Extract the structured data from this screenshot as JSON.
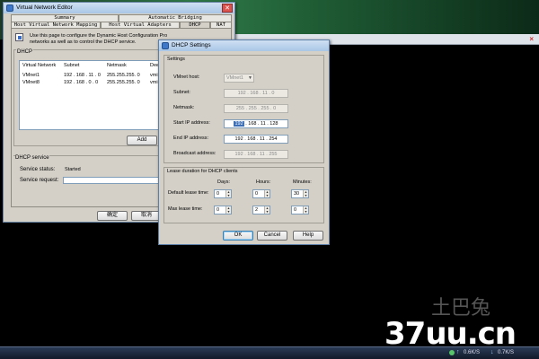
{
  "host": {
    "close_mark": "×"
  },
  "editor": {
    "title": "Virtual Network Editor",
    "tabs": [
      "Summary",
      "Automatic Bridging",
      "Host Virtual Network Mapping",
      "Host Virtual Adapters",
      "DHCP",
      "NAT"
    ],
    "description": [
      "Use this page to configure the Dynamic Host Configuration Pro",
      "networks as well as to control the DHCP service."
    ],
    "dhcp_group_label": "DHCP",
    "columns": [
      "Virtual Network",
      "Subnet",
      "Netmask",
      "Dee"
    ],
    "rows": [
      {
        "network": "VMnet1",
        "subnet": "192 . 168 . 11 . 0",
        "netmask": "255.255.255. 0",
        "extra": "vmi"
      },
      {
        "network": "VMnet8",
        "subnet": "192 . 168 . 0 . 0",
        "netmask": "255.255.255. 0",
        "extra": "vmi"
      }
    ],
    "add_button": "Add",
    "service_group_label": "DHCP service",
    "service_status_label": "Service status:",
    "service_status_value": "Started",
    "service_request_label": "Service request:",
    "service_request_value": "",
    "ok_button": "确定",
    "cancel_button": "取消"
  },
  "dhcp_settings": {
    "title": "DHCP Settings",
    "settings_label": "Settings",
    "vmnet_host_label": "VMnet host:",
    "vmnet_host_value": "VMnet1",
    "fields": [
      {
        "label": "Subnet:",
        "value": "192 . 168 . 11 . 0",
        "enabled": false
      },
      {
        "label": "Netmask:",
        "value": "255 . 255 . 255 . 0",
        "enabled": false
      },
      {
        "label": "Start IP address:",
        "first": "192",
        "rest": " . 168 . 11 . 128",
        "enabled": true
      },
      {
        "label": "End IP address:",
        "value": "192 . 168 . 11 . 254",
        "enabled": true
      },
      {
        "label": "Broadcast address:",
        "value": "192 . 168 . 11 . 255",
        "enabled": false
      }
    ],
    "lease_label": "Lease duration for DHCP clients",
    "col_days": "Days:",
    "col_hours": "Hours:",
    "col_minutes": "Minutes:",
    "default_lease_label": "Default lease time:",
    "default_lease": {
      "days": "0",
      "hours": "0",
      "minutes": "30"
    },
    "max_lease_label": "Max lease time:",
    "max_lease": {
      "days": "0",
      "hours": "2",
      "minutes": "0"
    },
    "ok_button": "OK",
    "cancel_button": "Cancel",
    "help_button": "Help"
  },
  "watermark": {
    "text": "37uu.cn",
    "faint": "土巴兔"
  },
  "taskbar": {
    "items": [
      "0.6K/S",
      "0.7K/S"
    ]
  }
}
